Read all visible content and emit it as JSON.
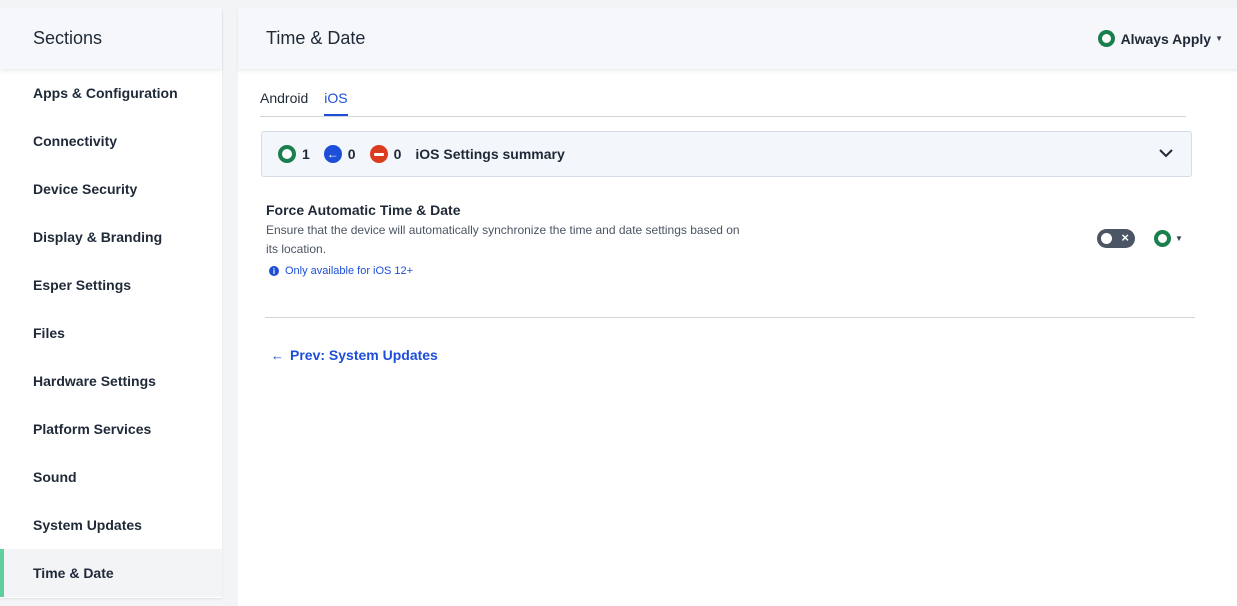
{
  "sidebar": {
    "title": "Sections",
    "items": [
      {
        "label": "Apps & Configuration"
      },
      {
        "label": "Connectivity"
      },
      {
        "label": "Device Security"
      },
      {
        "label": "Display & Branding"
      },
      {
        "label": "Esper Settings"
      },
      {
        "label": "Files"
      },
      {
        "label": "Hardware Settings"
      },
      {
        "label": "Platform Services"
      },
      {
        "label": "Sound"
      },
      {
        "label": "System Updates"
      },
      {
        "label": "Time & Date"
      }
    ],
    "active_item": "Time & Date"
  },
  "header": {
    "title": "Time & Date",
    "apply_label": "Always Apply"
  },
  "tabs": [
    {
      "label": "Android",
      "active": false
    },
    {
      "label": "iOS",
      "active": true
    }
  ],
  "summary": {
    "applied_count": "1",
    "inherited_count": "0",
    "blocked_count": "0",
    "label": "iOS Settings summary"
  },
  "setting": {
    "title": "Force Automatic Time & Date",
    "description": "Ensure that the device will automatically synchronize the time and date settings based on its location.",
    "note": "Only available for iOS 12+",
    "toggle_state": "off"
  },
  "footer": {
    "prev_label": "Prev: System Updates"
  },
  "colors": {
    "accent_blue": "#1d4ed8",
    "status_green": "#1a7f4e",
    "status_red": "#dc3c1e",
    "active_marker": "#5fcf9f"
  }
}
